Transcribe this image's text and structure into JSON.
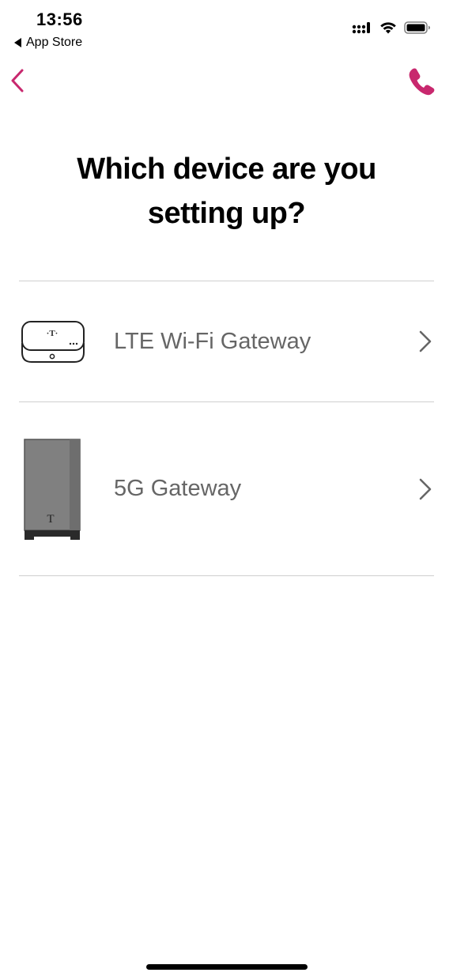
{
  "status_bar": {
    "time": "13:56",
    "back_app": "App Store"
  },
  "header": {
    "back_icon": "chevron-left-icon",
    "call_icon": "phone-icon",
    "accent_color": "#C8286E"
  },
  "main": {
    "title": "Which device are you setting up?",
    "devices": [
      {
        "label": "LTE Wi-Fi Gateway",
        "icon": "lte-gateway-icon"
      },
      {
        "label": "5G Gateway",
        "icon": "5g-gateway-icon"
      }
    ]
  }
}
